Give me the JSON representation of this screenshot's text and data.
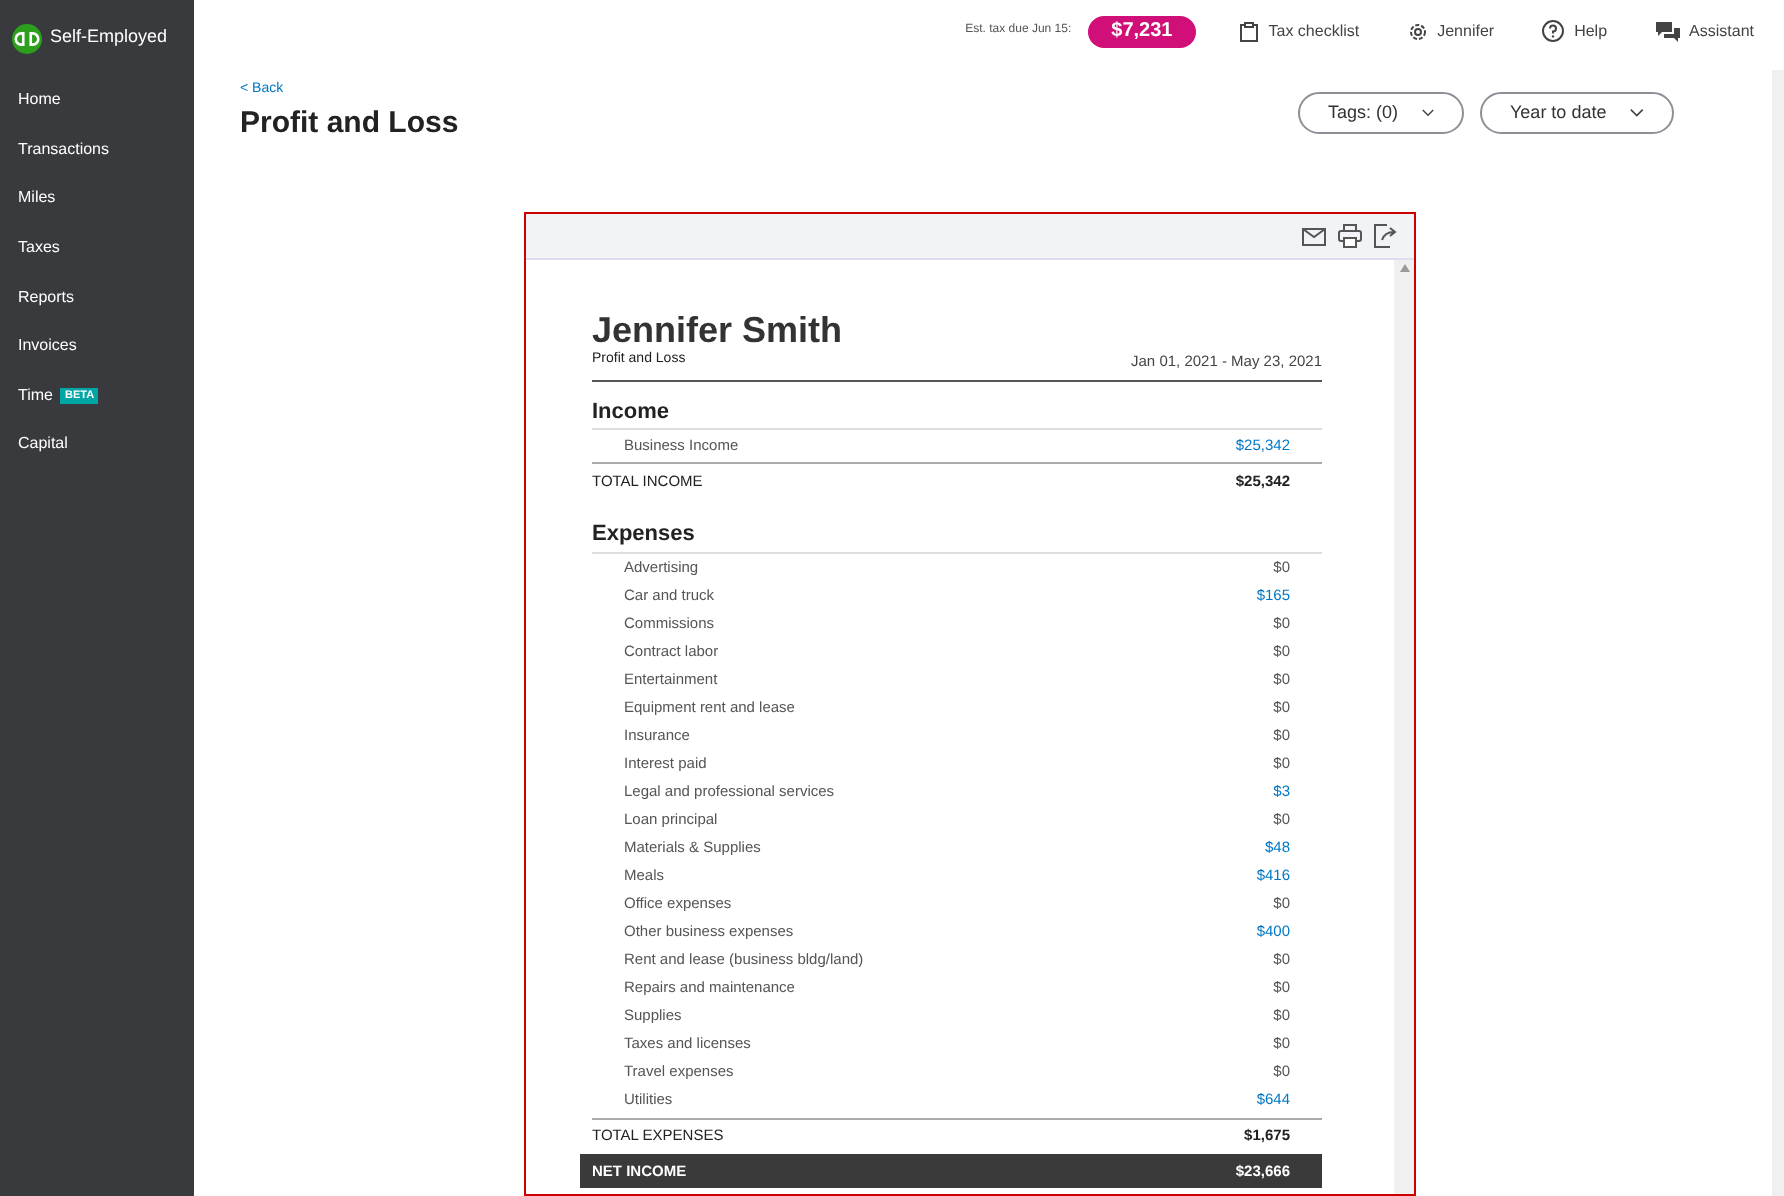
{
  "app": {
    "name": "Self-Employed"
  },
  "sidebar": {
    "items": [
      {
        "label": "Home",
        "selected": false
      },
      {
        "label": "Transactions",
        "selected": false
      },
      {
        "label": "Miles",
        "selected": false
      },
      {
        "label": "Taxes",
        "selected": false
      },
      {
        "label": "Reports",
        "selected": false
      },
      {
        "label": "Invoices",
        "selected": false
      },
      {
        "label": "Time",
        "badge": "BETA",
        "selected": false
      },
      {
        "label": "Capital",
        "selected": false
      }
    ]
  },
  "top_bar": {
    "tax_label": "Est. tax due Jun 15:",
    "tax_amount": "$7,231",
    "links": [
      {
        "kind": "checklist",
        "label": "Tax checklist"
      },
      {
        "kind": "gear",
        "label": "Jennifer"
      },
      {
        "kind": "help",
        "label": "Help"
      },
      {
        "kind": "chat",
        "label": "Assistant"
      }
    ]
  },
  "page": {
    "back": "< Back",
    "title": "Profit and Loss",
    "filters": [
      "Tags: (0)",
      "Year to date"
    ]
  },
  "report": {
    "name": "Jennifer Smith",
    "subtitle": "Profit and Loss",
    "period": "Jan 01, 2021 - May 23, 2021",
    "sections": [
      {
        "title": "Income",
        "rows": [
          {
            "label": "Business Income",
            "amount": "$25,342",
            "linked": true
          }
        ],
        "total_label": "TOTAL INCOME",
        "total": "$25,342"
      },
      {
        "title": "Expenses",
        "rows": [
          {
            "label": "Advertising",
            "amount": "$0",
            "linked": false
          },
          {
            "label": "Car and truck",
            "amount": "$165",
            "linked": true
          },
          {
            "label": "Commissions",
            "amount": "$0",
            "linked": false
          },
          {
            "label": "Contract labor",
            "amount": "$0",
            "linked": false
          },
          {
            "label": "Entertainment",
            "amount": "$0",
            "linked": false
          },
          {
            "label": "Equipment rent and lease",
            "amount": "$0",
            "linked": false
          },
          {
            "label": "Insurance",
            "amount": "$0",
            "linked": false
          },
          {
            "label": "Interest paid",
            "amount": "$0",
            "linked": false
          },
          {
            "label": "Legal and professional services",
            "amount": "$3",
            "linked": true
          },
          {
            "label": "Loan principal",
            "amount": "$0",
            "linked": false
          },
          {
            "label": "Materials & Supplies",
            "amount": "$48",
            "linked": true
          },
          {
            "label": "Meals",
            "amount": "$416",
            "linked": true
          },
          {
            "label": "Office expenses",
            "amount": "$0",
            "linked": false
          },
          {
            "label": "Other business expenses",
            "amount": "$400",
            "linked": true
          },
          {
            "label": "Rent and lease (business bldg/land)",
            "amount": "$0",
            "linked": false
          },
          {
            "label": "Repairs and maintenance",
            "amount": "$0",
            "linked": false
          },
          {
            "label": "Supplies",
            "amount": "$0",
            "linked": false
          },
          {
            "label": "Taxes and licenses",
            "amount": "$0",
            "linked": false
          },
          {
            "label": "Travel expenses",
            "amount": "$0",
            "linked": false
          },
          {
            "label": "Utilities",
            "amount": "$644",
            "linked": true
          }
        ],
        "total_label": "TOTAL EXPENSES",
        "total": "$1,675"
      }
    ],
    "net_label": "NET INCOME",
    "net": "$23,666"
  }
}
